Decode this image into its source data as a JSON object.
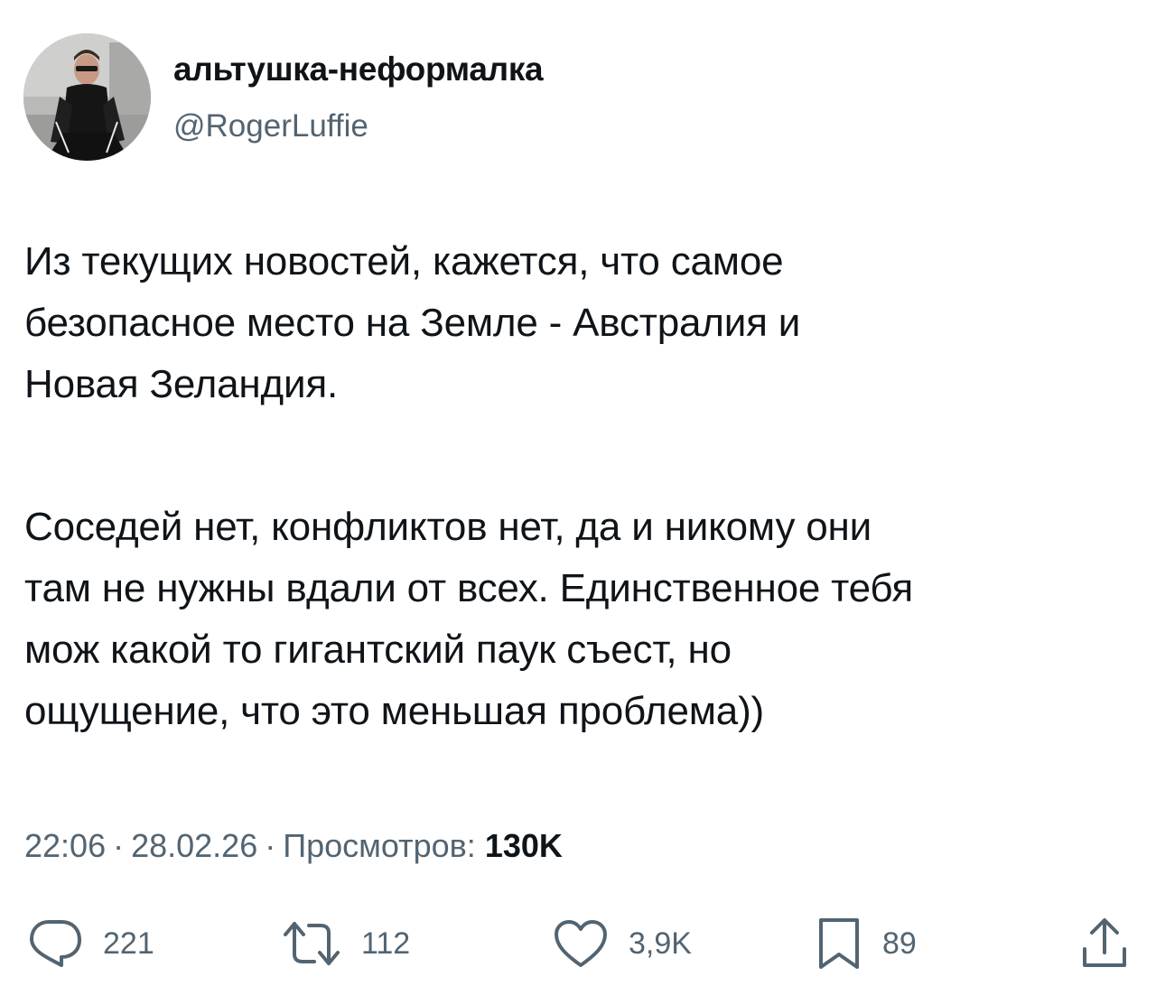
{
  "author": {
    "display_name": "альтушка-неформалка",
    "handle": "@RogerLuffie"
  },
  "tweet": {
    "paragraphs": [
      [
        "Из текущих новостей, кажется, что самое",
        "безопасное место на Земле - Австралия и",
        "Новая Зеландия."
      ],
      [
        "Соседей нет, конфликтов нет, да и никому они",
        "там не нужны вдали от всех. Единственное тебя",
        "мож какой то гигантский паук съест, но",
        "ощущение, что это меньшая проблема))"
      ]
    ]
  },
  "meta": {
    "time": "22:06",
    "date": "28.02.26",
    "views_label": "Просмотров:",
    "views_count": "130K",
    "separator": "·"
  },
  "actions": {
    "replies": "221",
    "retweets": "112",
    "likes": "3,9K",
    "bookmarks": "89"
  },
  "colors": {
    "text": "#0f1419",
    "secondary": "#536471",
    "background": "#ffffff"
  },
  "icons": [
    "reply-icon",
    "retweet-icon",
    "like-icon",
    "bookmark-icon",
    "share-icon"
  ]
}
